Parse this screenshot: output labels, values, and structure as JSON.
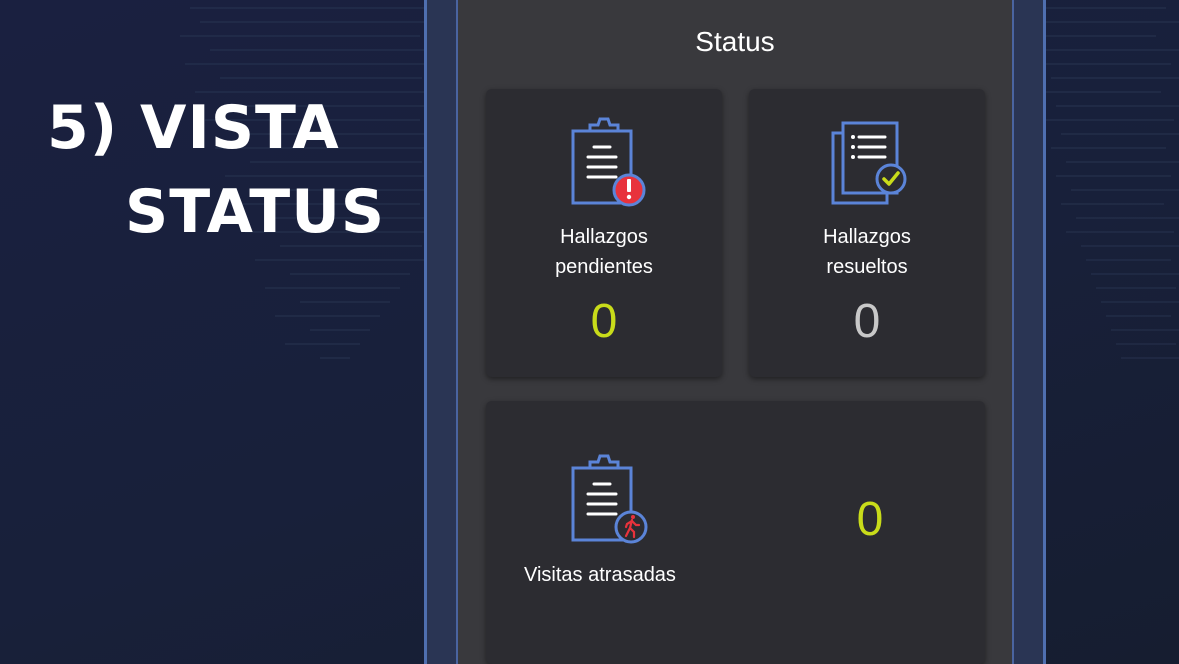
{
  "slide": {
    "title_line1": "5) VISTA",
    "title_line2": "STATUS"
  },
  "screen": {
    "title": "Status"
  },
  "cards": [
    {
      "label_line1": "Hallazgos",
      "label_line2": "pendientes",
      "value": "0",
      "icon": "clipboard-alert-icon",
      "value_color": "#c9dc1a"
    },
    {
      "label_line1": "Hallazgos",
      "label_line2": "resueltos",
      "value": "0",
      "icon": "clipboard-check-icon",
      "value_color": "#c8c8c8"
    },
    {
      "label": "Visitas atrasadas",
      "value": "0",
      "icon": "clipboard-walking-icon",
      "value_color": "#c9dc1a"
    }
  ],
  "colors": {
    "background": "#1a2040",
    "frame": "#2a3554",
    "frame_border": "#4f6fb0",
    "screen": "#39393d",
    "card": "#2c2c31",
    "icon_blue": "#5b84d8",
    "alert_red": "#e8323c",
    "accent_yellow": "#c9dc1a"
  }
}
